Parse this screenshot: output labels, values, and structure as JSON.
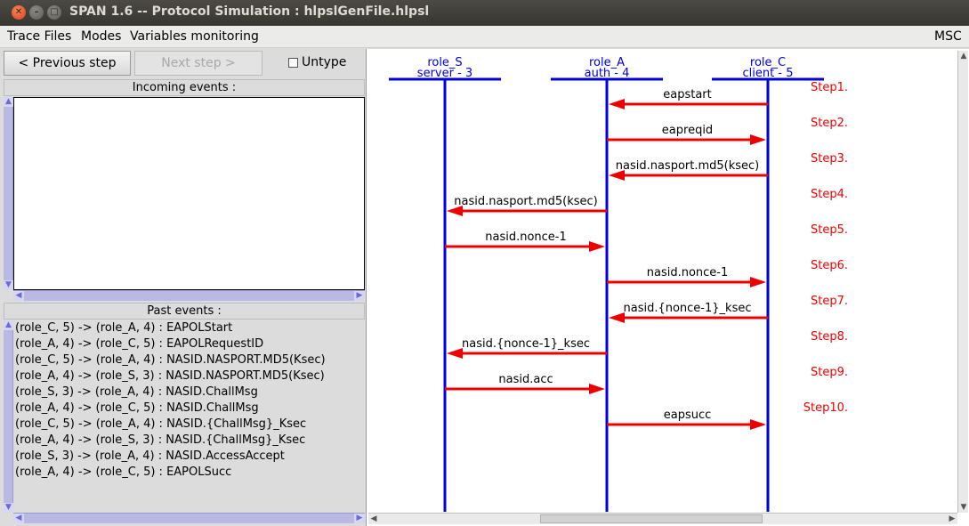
{
  "window": {
    "title": "SPAN 1.6 -- Protocol Simulation : hlpslGenFile.hlpsl",
    "close_glyph": "✕",
    "min_glyph": "–",
    "max_glyph": "□"
  },
  "menubar": {
    "items": [
      "Trace Files",
      "Modes",
      "Variables monitoring"
    ],
    "right_item": "MSC"
  },
  "controls": {
    "previous_step": "< Previous step",
    "next_step": "Next step >",
    "untype_label": "Untype",
    "untype_checked": false
  },
  "incoming": {
    "label": "Incoming events :",
    "items": []
  },
  "past": {
    "label": "Past events :",
    "items": [
      "(role_C, 5) -> (role_A, 4) : EAPOLStart",
      "(role_A, 4) -> (role_C, 5) : EAPOLRequestID",
      "(role_C, 5) -> (role_A, 4) : NASID.NASPORT.MD5(Ksec)",
      "(role_A, 4) -> (role_S, 3) : NASID.NASPORT.MD5(Ksec)",
      "(role_S, 3) -> (role_A, 4) : NASID.ChallMsg",
      "(role_A, 4) -> (role_C, 5) : NASID.ChallMsg",
      "(role_C, 5) -> (role_A, 4) : NASID.{ChallMsg}_Ksec",
      "(role_A, 4) -> (role_S, 3) : NASID.{ChallMsg}_Ksec",
      "(role_S, 3) -> (role_A, 4) : NASID.AccessAccept",
      "(role_A, 4) -> (role_C, 5) : EAPOLSucc"
    ]
  },
  "msc": {
    "colors": {
      "lifeline": "#0000dd",
      "arrow": "#ee0000",
      "step": "#ee0000",
      "role": "#0000dd"
    },
    "roles": [
      {
        "id": "S",
        "name": "role_S",
        "sub": "server - 3"
      },
      {
        "id": "A",
        "name": "role_A",
        "sub": "auth - 4"
      },
      {
        "id": "C",
        "name": "role_C",
        "sub": "client - 5"
      }
    ],
    "messages": [
      {
        "step": "Step1.",
        "from": "C",
        "to": "A",
        "label": "eapstart"
      },
      {
        "step": "Step2.",
        "from": "A",
        "to": "C",
        "label": "eapreqid"
      },
      {
        "step": "Step3.",
        "from": "C",
        "to": "A",
        "label": "nasid.nasport.md5(ksec)"
      },
      {
        "step": "Step4.",
        "from": "A",
        "to": "S",
        "label": "nasid.nasport.md5(ksec)"
      },
      {
        "step": "Step5.",
        "from": "S",
        "to": "A",
        "label": "nasid.nonce-1"
      },
      {
        "step": "Step6.",
        "from": "A",
        "to": "C",
        "label": "nasid.nonce-1"
      },
      {
        "step": "Step7.",
        "from": "C",
        "to": "A",
        "label": "nasid.{nonce-1}_ksec"
      },
      {
        "step": "Step8.",
        "from": "A",
        "to": "S",
        "label": "nasid.{nonce-1}_ksec"
      },
      {
        "step": "Step9.",
        "from": "S",
        "to": "A",
        "label": "nasid.acc"
      },
      {
        "step": "Step10.",
        "from": "A",
        "to": "C",
        "label": "eapsucc"
      }
    ]
  }
}
